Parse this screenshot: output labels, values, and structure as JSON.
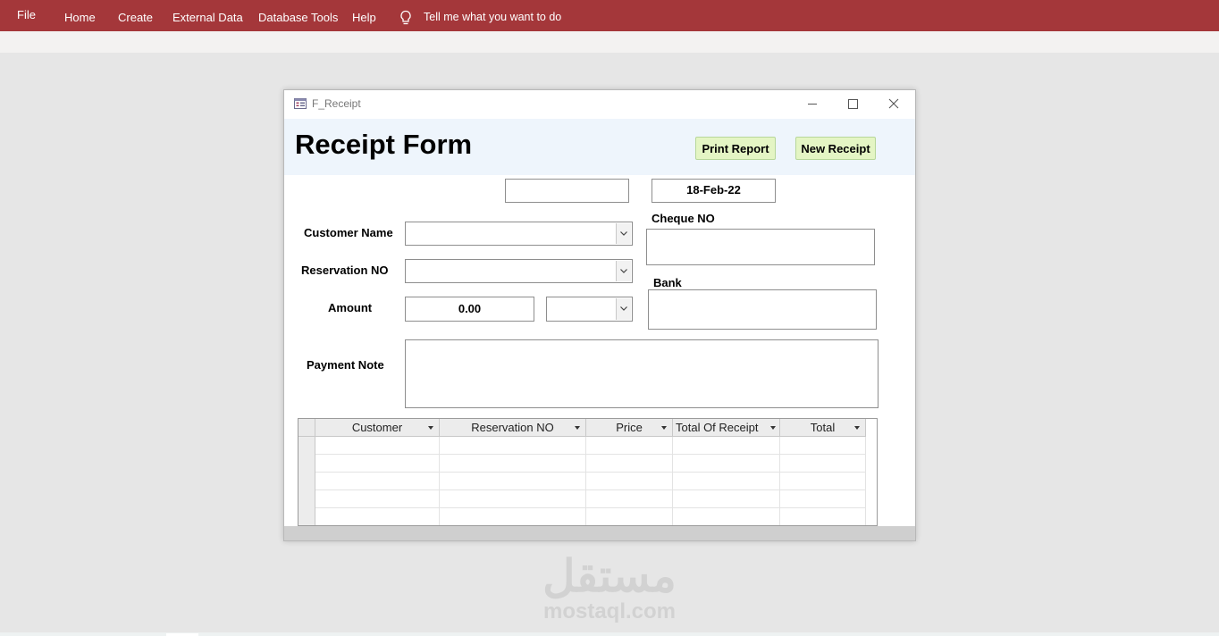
{
  "ribbon": {
    "tabs": [
      "File",
      "Home",
      "Create",
      "External Data",
      "Database Tools",
      "Help"
    ],
    "tell_me": "Tell me what you want to do"
  },
  "window": {
    "title": "F_Receipt",
    "form_title": "Receipt Form",
    "buttons": {
      "print": "Print Report",
      "new": "New Receipt"
    }
  },
  "fields": {
    "receipt_no": {
      "value": ""
    },
    "date": {
      "value": "18-Feb-22"
    },
    "customer_name": {
      "label": "Customer Name",
      "value": ""
    },
    "reservation_no": {
      "label": "Reservation NO",
      "value": ""
    },
    "amount": {
      "label": "Amount",
      "value": "0.00"
    },
    "currency": {
      "value": ""
    },
    "cheque_no": {
      "label": "Cheque NO",
      "value": ""
    },
    "bank": {
      "label": "Bank",
      "value": ""
    },
    "payment_note": {
      "label": "Payment Note",
      "value": ""
    }
  },
  "datasheet": {
    "columns": [
      "Customer",
      "Reservation NO",
      "Price",
      "Total Of Receipt",
      "Total"
    ],
    "rows": []
  },
  "watermark": {
    "arabic": "مستقل",
    "latin": "mostaql.com"
  },
  "colors": {
    "ribbon": "#a4373a",
    "header": "#eef5fc",
    "button": "#e4f5c4"
  }
}
